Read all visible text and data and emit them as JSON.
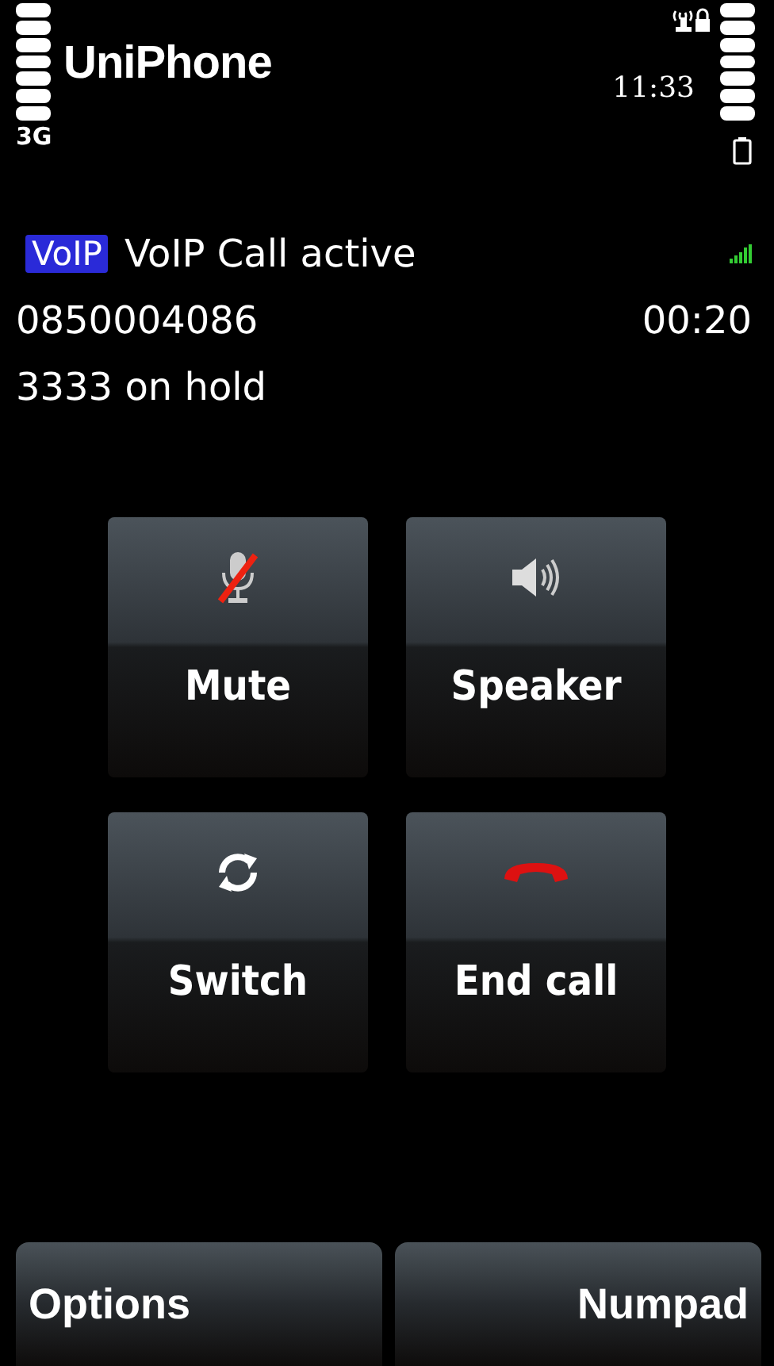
{
  "status_bar": {
    "app_title": "UniPhone",
    "time": "11:33",
    "network": "3G"
  },
  "call": {
    "badge": "VoIP",
    "status": "VoIP Call active",
    "number": "0850004086",
    "duration": "00:20",
    "held": "3333 on hold"
  },
  "actions": [
    {
      "kind": "mute",
      "label": "Mute"
    },
    {
      "kind": "speaker",
      "label": "Speaker"
    },
    {
      "kind": "switch",
      "label": "Switch"
    },
    {
      "kind": "end",
      "label": "End call"
    }
  ],
  "softkeys": [
    "Options",
    "Numpad"
  ]
}
